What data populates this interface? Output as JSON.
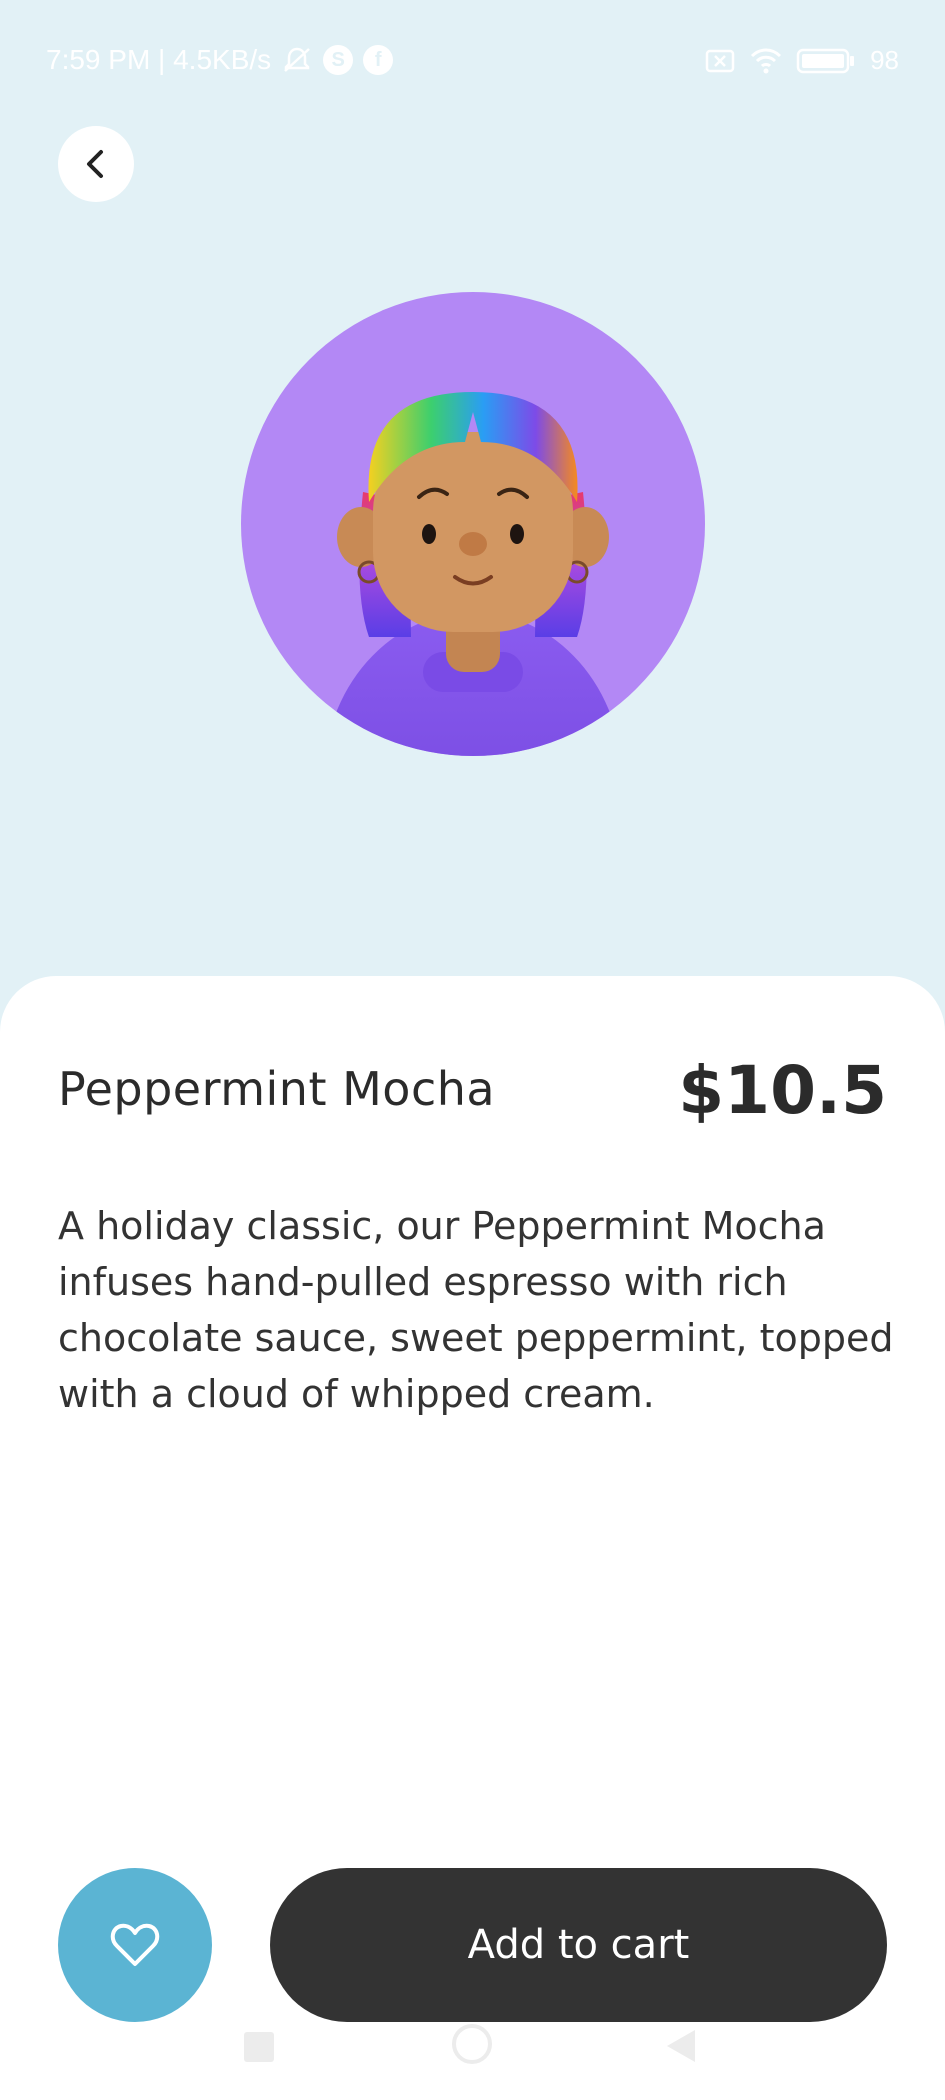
{
  "status_bar": {
    "left_text": "7:59 PM | 4.5KB/s",
    "icons_left": [
      "mute-bell-icon",
      "skype-icon",
      "facebook-icon"
    ],
    "icons_right": [
      "sim-off-icon",
      "wifi-icon",
      "battery-icon"
    ],
    "battery_percent": "98"
  },
  "header": {
    "back_icon": "chevron-left-icon"
  },
  "avatar": {
    "background_color": "#b388f5"
  },
  "product": {
    "title": "Peppermint Mocha",
    "price": "$10.5",
    "description": "A holiday classic, our Peppermint Mocha infuses hand-pulled espresso with rich chocolate sauce, sweet peppermint, topped with a cloud of whipped cream."
  },
  "actions": {
    "favorite_icon": "heart-icon",
    "add_to_cart_label": "Add to cart"
  },
  "colors": {
    "background": "#e2f1f6",
    "favorite_button": "#5bb4d3",
    "cart_button": "#333333",
    "text_primary": "#2b2b2b"
  },
  "nav_bar": {
    "buttons": [
      "recents-icon",
      "home-icon",
      "back-icon"
    ]
  }
}
